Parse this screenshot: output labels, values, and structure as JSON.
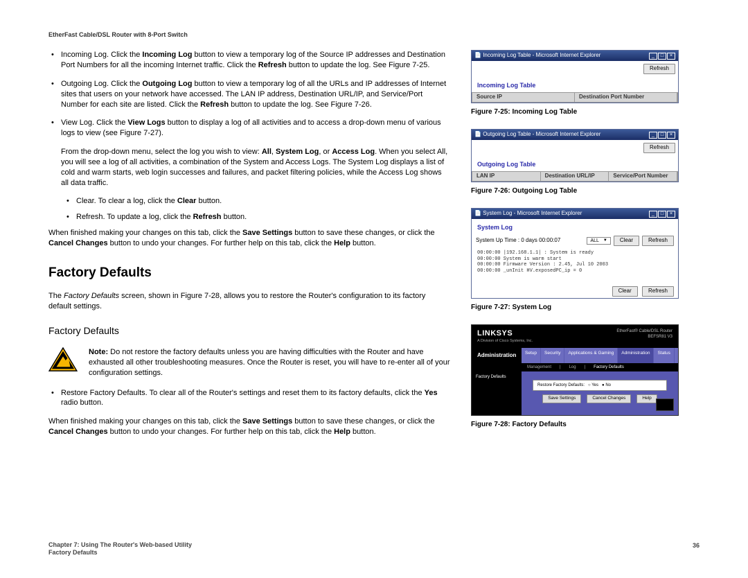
{
  "doc_title": "EtherFast Cable/DSL Router with 8-Port Switch",
  "body": {
    "incoming": {
      "lead": "Incoming Log. Click the ",
      "btn": "Incoming Log",
      "tail": " button to view a temporary log of the Source IP addresses and Destination Port Numbers for all the incoming Internet traffic. Click the ",
      "btn2": "Refresh",
      "tail2": " button to update the log. See Figure 7-25."
    },
    "outgoing": {
      "lead": "Outgoing Log. Click the ",
      "btn": "Outgoing Log",
      "tail": " button to view a temporary log of all the URLs and IP addresses of Internet sites that users on your network have accessed. The LAN IP address, Destination URL/IP, and Service/Port Number for each site are listed. Click the ",
      "btn2": "Refresh",
      "tail2": " button to update the log. See Figure 7-26."
    },
    "viewlog": {
      "lead": "View Log. Click the ",
      "btn": "View Logs",
      "tail": " button to display a log of all activities and to access a drop-down menu of various logs to view (see Figure 7-27)."
    },
    "dropdown": {
      "lead": "From the drop-down menu, select the log you wish to view: ",
      "opts": "All",
      "sep1": ", ",
      "opt2": "System Log",
      "sep2": ", or ",
      "opt3": "Access Log",
      "tail": ". When you select All, you will see a log of all activities, a combination of the System and Access Logs. The System Log displays a list of cold and warm starts, web login successes and failures, and packet filtering policies, while the Access Log shows all data traffic."
    },
    "clear": {
      "lead": "Clear. To clear a log, click the ",
      "btn": "Clear",
      "tail": " button."
    },
    "refresh": {
      "lead": "Refresh. To update a log, click the ",
      "btn": "Refresh",
      "tail": " button."
    },
    "save_para1": {
      "lead": "When finished making your changes on this tab, click the ",
      "btn": "Save Settings",
      "mid": " button to save these changes, or click the ",
      "btn2": "Cancel Changes",
      "mid2": " button to undo your changes. For further help on this tab, click the ",
      "btn3": "Help",
      "tail": " button."
    },
    "section": "Factory Defaults",
    "fd_para": {
      "lead": "The ",
      "em": "Factory Defaults",
      "tail": " screen, shown in Figure 7-28, allows you to restore the Router's configuration to its factory default settings."
    },
    "subsection": "Factory Defaults",
    "note": {
      "label": "Note:",
      "text": " Do not restore the factory defaults unless you are having difficulties with the Router and have exhausted all other troubleshooting measures. Once the Router is reset, you will have to re-enter all of your configuration settings."
    },
    "restore": {
      "lead": "Restore Factory Defaults. To clear all of the Router's settings and reset them to its factory defaults, click the ",
      "btn": "Yes",
      "tail": " radio button."
    },
    "save_para2": {
      "lead": "When finished making your changes on this tab, click the ",
      "btn": "Save Settings",
      "mid": " button to save these changes, or click the ",
      "btn2": "Cancel Changes",
      "mid2": " button to undo your changes. For further help on this tab, click the ",
      "btn3": "Help",
      "tail": " button."
    }
  },
  "figs": {
    "f25": {
      "titlebar": "Incoming Log Table - Microsoft Internet Explorer",
      "heading": "Incoming Log Table",
      "refresh": "Refresh",
      "col1": "Source IP",
      "col2": "Destination Port Number",
      "caption": "Figure 7-25: Incoming Log Table"
    },
    "f26": {
      "titlebar": "Outgoing Log Table - Microsoft Internet Explorer",
      "heading": "Outgoing Log Table",
      "refresh": "Refresh",
      "col1": "LAN IP",
      "col2": "Destination URL/IP",
      "col3": "Service/Port Number",
      "caption": "Figure 7-26: Outgoing Log Table"
    },
    "f27": {
      "titlebar": "System Log - Microsoft Internet Explorer",
      "heading": "System Log",
      "uptime": "System Up Time : 0 days 00:00:07",
      "sel": "ALL",
      "clear": "Clear",
      "refresh": "Refresh",
      "loglines": "00:00:00 |192.168.1.1| : System is ready\n00:00:00 System is warm start\n00:00:00 Firmware Version : 2.45, Jul 10 2003\n00:00:00 _unInit HV.exposedPC_ip = 0",
      "caption": "Figure 7-27: System Log"
    },
    "f28": {
      "linksys": "LINKSYS",
      "subl": "A Division of Cisco Systems, Inc.",
      "model_r1": "EtherFast® Cable/DSL Router",
      "model_r2": "BEFSR81 V3",
      "admin": "Administration",
      "tabs": [
        "Setup",
        "Security",
        "Applications & Gaming",
        "Administration",
        "Status"
      ],
      "subtabs": [
        "Management",
        "Log",
        "Factory Defaults"
      ],
      "navitem": "Factory Defaults",
      "label": "Restore Factory Defaults:",
      "optYes": "Yes",
      "optNo": "No",
      "save": "Save Settings",
      "cancel": "Cancel Changes",
      "help": "Help",
      "caption": "Figure 7-28: Factory Defaults"
    }
  },
  "footer": {
    "line1": "Chapter 7: Using The Router's Web-based Utility",
    "line2": "Factory Defaults",
    "page": "36"
  }
}
